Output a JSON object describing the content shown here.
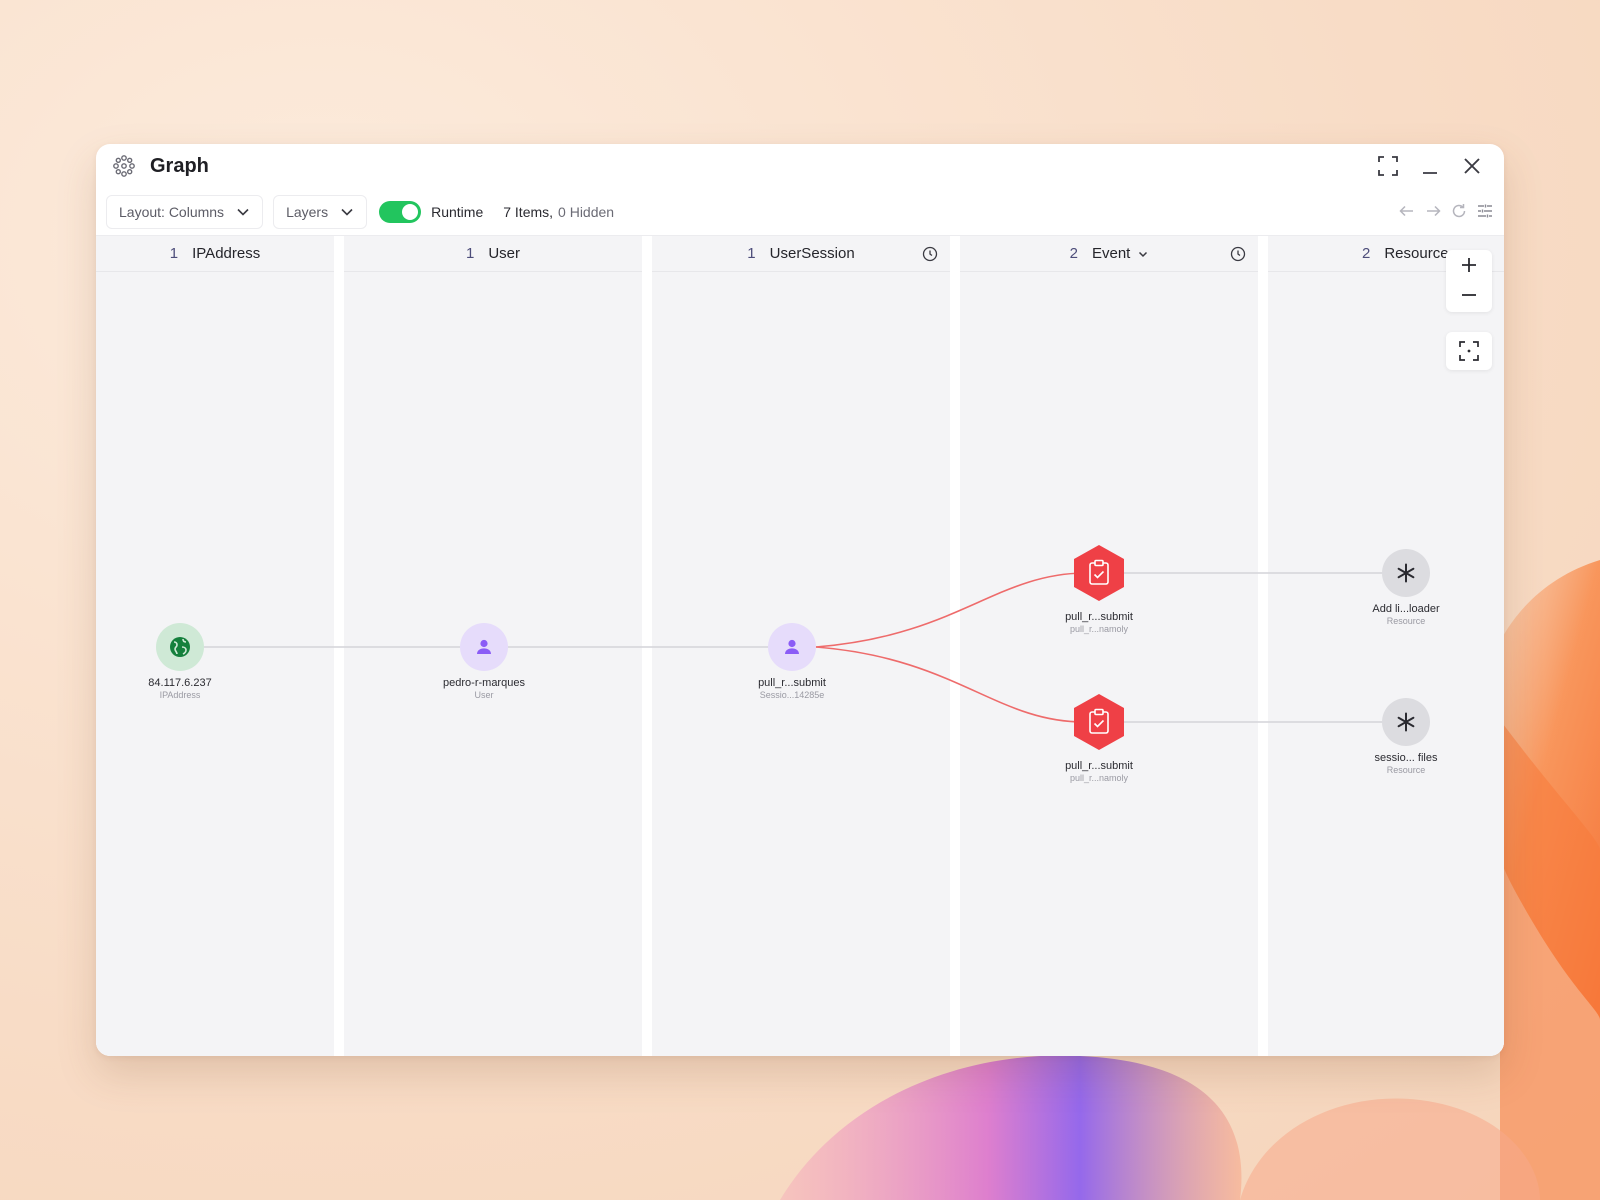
{
  "window": {
    "title": "Graph"
  },
  "toolbar": {
    "layout_label": "Layout: Columns",
    "layers_label": "Layers",
    "runtime_label": "Runtime",
    "runtime_enabled": true,
    "items_count": "7 Items,",
    "hidden_count": "0 Hidden"
  },
  "columns": [
    {
      "count": "1",
      "name": "IPAddress",
      "has_clock": false,
      "has_chevron": false
    },
    {
      "count": "1",
      "name": "User",
      "has_clock": false,
      "has_chevron": false
    },
    {
      "count": "1",
      "name": "UserSession",
      "has_clock": true,
      "has_chevron": false
    },
    {
      "count": "2",
      "name": "Event",
      "has_clock": true,
      "has_chevron": true
    },
    {
      "count": "2",
      "name": "Resource",
      "has_clock": false,
      "has_chevron": false
    }
  ],
  "nodes": [
    {
      "label": "84.117.6.237",
      "sub": "IPAddress",
      "icon": "globe-icon"
    },
    {
      "label": "pedro-r-marques",
      "sub": "User",
      "icon": "user-icon"
    },
    {
      "label": "pull_r...submit",
      "sub": "Sessio...14285e",
      "icon": "user-icon"
    },
    {
      "label": "pull_r...submit",
      "sub": "pull_r...namoly",
      "icon": "clipboard-check-icon"
    },
    {
      "label": "pull_r...submit",
      "sub": "pull_r...namoly",
      "icon": "clipboard-check-icon"
    },
    {
      "label": "Add li...loader",
      "sub": "Resource",
      "icon": "asterisk-icon"
    },
    {
      "label": "sessio... files",
      "sub": "Resource",
      "icon": "asterisk-icon"
    }
  ],
  "colors": {
    "toggle_on": "#22c55e",
    "event_red": "#ef4046",
    "user_purple": "#8b5cf6",
    "ip_green": "#15803d",
    "edge_red": "#ee6b6b",
    "edge_gray": "#d4d4d8"
  }
}
